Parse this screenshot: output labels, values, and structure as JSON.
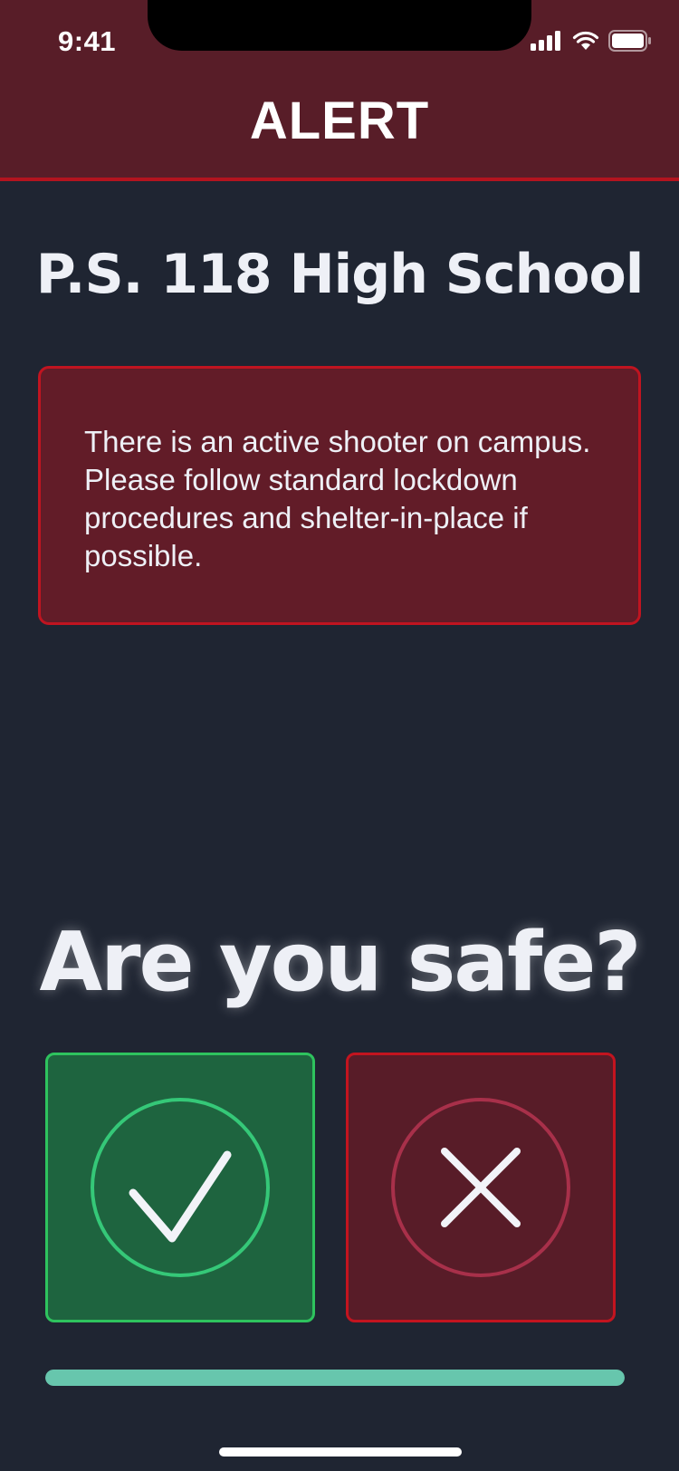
{
  "status_bar": {
    "time": "9:41",
    "icons": [
      "cellular-signal-icon",
      "wifi-icon",
      "battery-icon"
    ]
  },
  "header": {
    "title": "ALERT"
  },
  "school": {
    "name": "P.S. 118 High School"
  },
  "message": {
    "text": "There is an active shooter on campus. Please follow standard lockdown procedures and shelter-in-place if possible."
  },
  "prompt": {
    "question": "Are you safe?"
  },
  "buttons": {
    "yes_icon": "checkmark-icon",
    "no_icon": "x-icon"
  },
  "progress": {
    "value": 1.0
  },
  "colors": {
    "background": "#1f2532",
    "header": "#581d28",
    "alert_border": "#b3141f",
    "safe_green": "#1e643f",
    "safe_border": "#2ec35e",
    "unsafe_red": "#581c28",
    "progress": "#67c6ad"
  }
}
